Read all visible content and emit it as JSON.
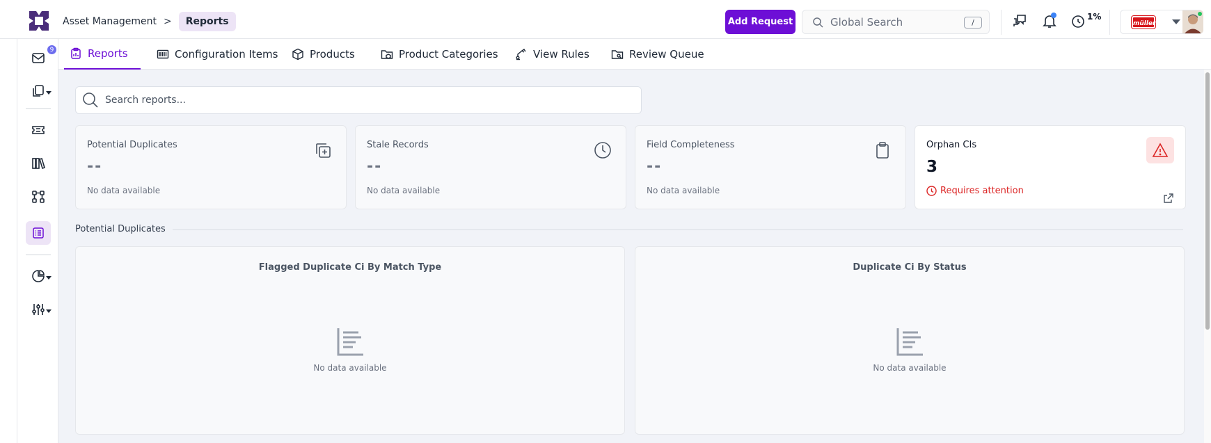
{
  "header": {
    "breadcrumb_root": "Asset Management",
    "breadcrumb_sep": ">",
    "breadcrumb_current": "Reports",
    "add_request_label": "Add Request",
    "global_search_placeholder": "Global Search",
    "search_shortcut": "/",
    "progress_label": "1%",
    "org_logo_text": "müller"
  },
  "sidebar": {
    "inbox_badge": "9",
    "items": [
      "inbox-icon",
      "copy-icon",
      "ticket-icon",
      "library-icon",
      "workflow-icon",
      "reports-icon",
      "chart-pie-icon",
      "sliders-icon"
    ],
    "active_item": "reports-icon"
  },
  "tabs": [
    {
      "label": "Reports",
      "active": true
    },
    {
      "label": "Configuration Items",
      "active": false
    },
    {
      "label": "Products",
      "active": false
    },
    {
      "label": "Product Categories",
      "active": false
    },
    {
      "label": "View Rules",
      "active": false
    },
    {
      "label": "Review Queue",
      "active": false
    }
  ],
  "report_search": {
    "placeholder": "Search reports...",
    "value": ""
  },
  "cards": [
    {
      "title": "Potential Duplicates",
      "value": "--",
      "sub": "No data available",
      "icon": "copy-plus-icon"
    },
    {
      "title": "Stale Records",
      "value": "--",
      "sub": "No data available",
      "icon": "clock-icon"
    },
    {
      "title": "Field Completeness",
      "value": "--",
      "sub": "No data available",
      "icon": "clipboard-icon"
    },
    {
      "title": "Orphan CIs",
      "value": "3",
      "sub": "Requires attention",
      "icon": "alert-triangle-icon"
    }
  ],
  "section": {
    "title": "Potential Duplicates"
  },
  "charts": [
    {
      "title": "Flagged Duplicate Ci By Match Type",
      "empty_text": "No data available"
    },
    {
      "title": "Duplicate Ci By Status",
      "empty_text": "No data available"
    }
  ],
  "colors": {
    "accent": "#6d0fd6",
    "alert": "#dc2626",
    "active_bg": "#ede4f6"
  }
}
